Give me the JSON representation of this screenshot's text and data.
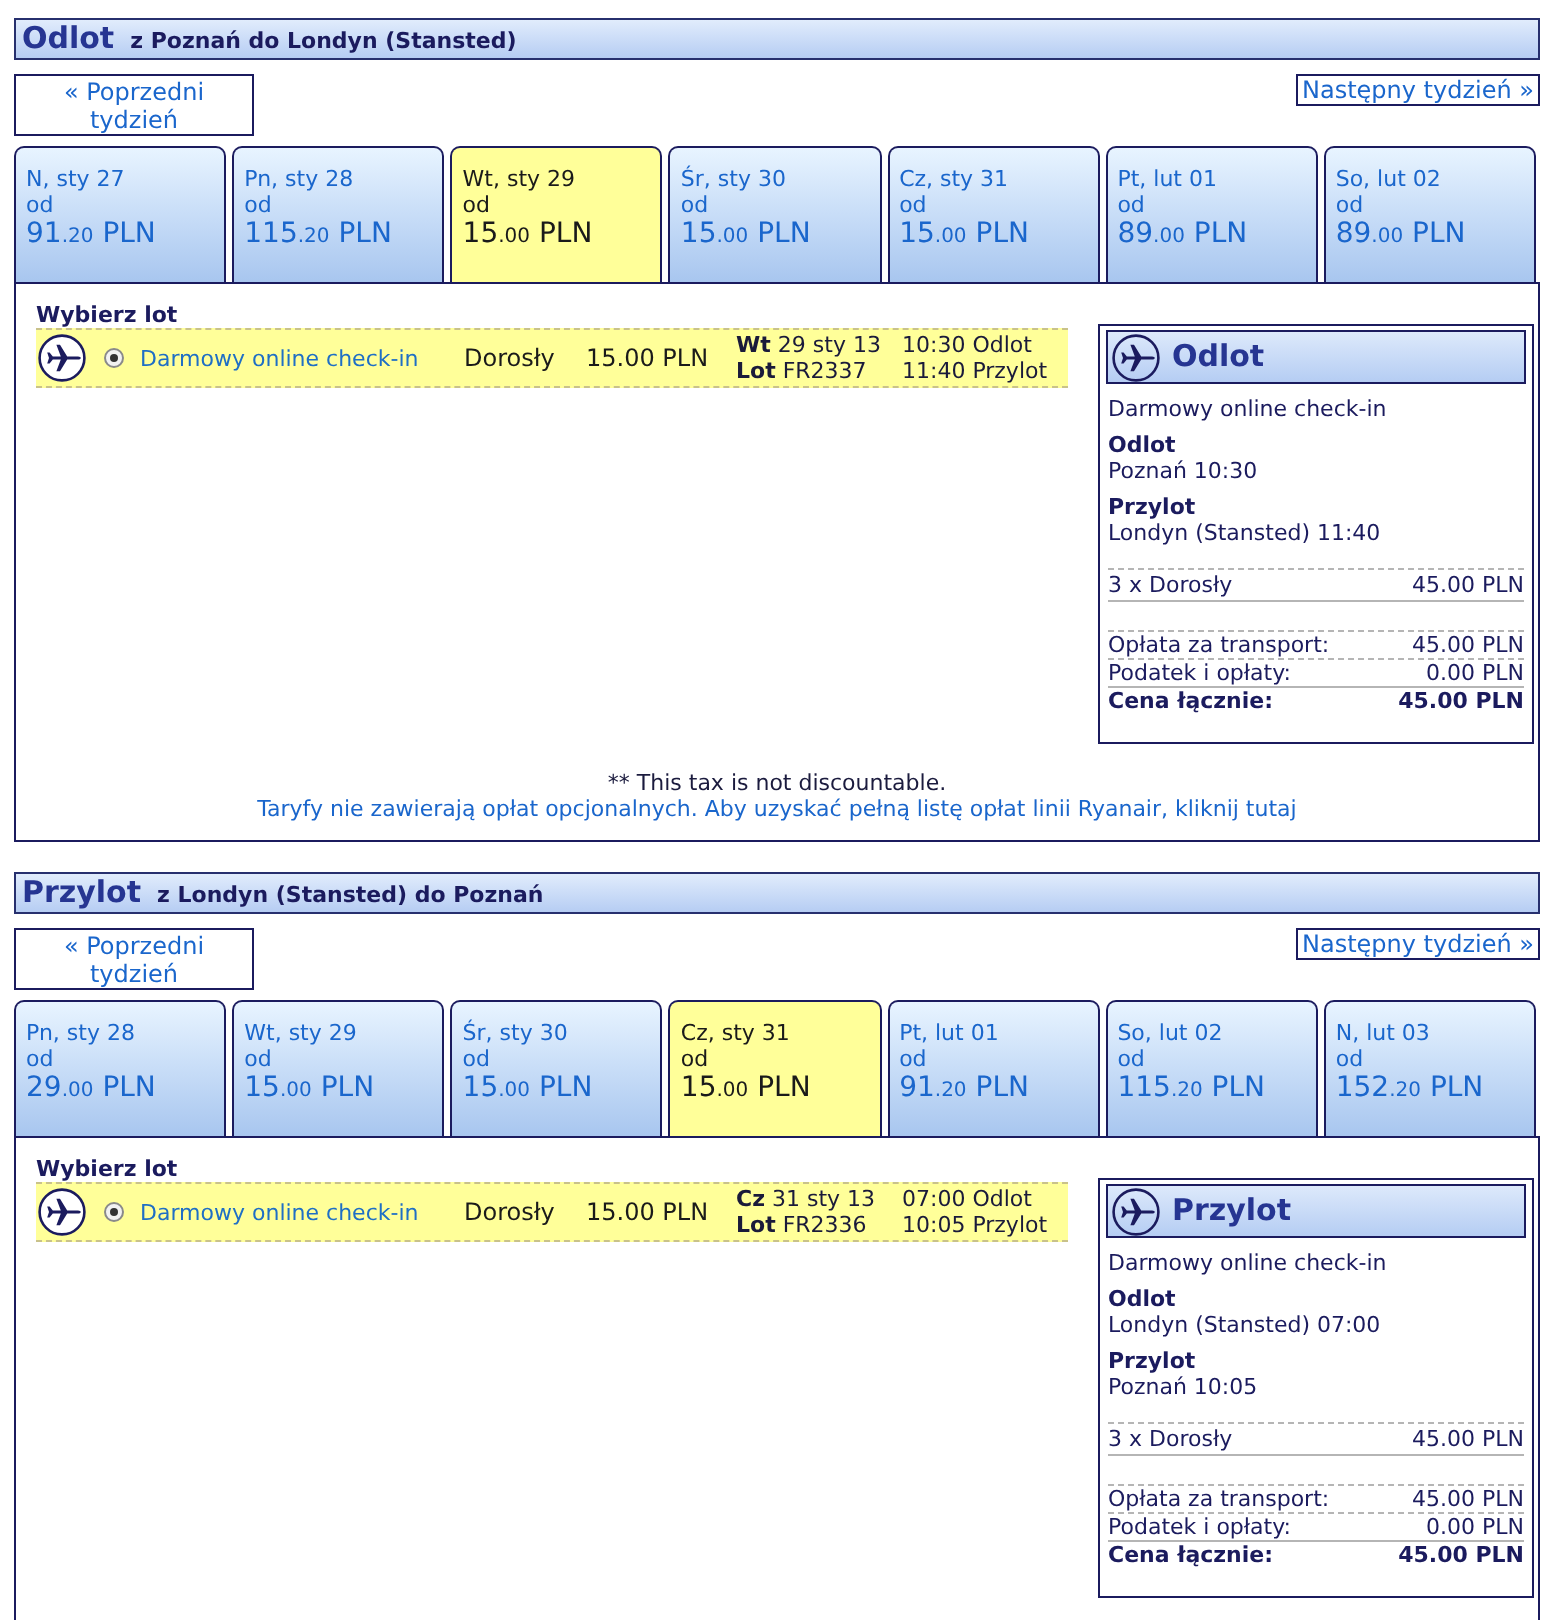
{
  "sections": [
    {
      "title": "Odlot",
      "route": "z Poznań do Londyn (Stansted)",
      "prev_week": "« Poprzedni tydzień",
      "next_week": "Następny tydzień »",
      "date_tabs": [
        {
          "date": "N, sty 27",
          "from": "od",
          "price": {
            "whole": "91",
            "fraction": ".20",
            "currency": "PLN"
          },
          "selected": false
        },
        {
          "date": "Pn, sty 28",
          "from": "od",
          "price": {
            "whole": "115",
            "fraction": ".20",
            "currency": "PLN"
          },
          "selected": false
        },
        {
          "date": "Wt, sty 29",
          "from": "od",
          "price": {
            "whole": "15",
            "fraction": ".00",
            "currency": "PLN"
          },
          "selected": true
        },
        {
          "date": "Śr, sty 30",
          "from": "od",
          "price": {
            "whole": "15",
            "fraction": ".00",
            "currency": "PLN"
          },
          "selected": false
        },
        {
          "date": "Cz, sty 31",
          "from": "od",
          "price": {
            "whole": "15",
            "fraction": ".00",
            "currency": "PLN"
          },
          "selected": false
        },
        {
          "date": "Pt, lut 01",
          "from": "od",
          "price": {
            "whole": "89",
            "fraction": ".00",
            "currency": "PLN"
          },
          "selected": false
        },
        {
          "date": "So, lut 02",
          "from": "od",
          "price": {
            "whole": "89",
            "fraction": ".00",
            "currency": "PLN"
          },
          "selected": false
        }
      ],
      "flight_list": {
        "heading": "Wybierz lot",
        "flights": [
          {
            "selected": true,
            "fare": "Darmowy online check-in",
            "passenger": "Dorosły",
            "price": "15.00 PLN",
            "date": "**Wt** 29 sty 13",
            "flight_number": "**Lot** FR2337",
            "departure": "10:30 Odlot",
            "arrival": "11:40 Przylot"
          }
        ]
      },
      "summary": {
        "title": "Odlot",
        "fare": "Darmowy online check-in",
        "departure_label": "Odlot",
        "departure": "Poznań 10:30",
        "arrival_label": "Przylot",
        "arrival": "Londyn (Stansted) 11:40",
        "passengers": {
          "label": "3 x Dorosły",
          "amount": "45.00 PLN"
        },
        "charges": [
          {
            "label": "Opłata za transport:",
            "amount": "45.00 PLN"
          },
          {
            "label": "Podatek i opłaty:",
            "amount": "0.00 PLN"
          }
        ],
        "total": {
          "label": "Cena łącznie:",
          "amount": "45.00 PLN"
        }
      },
      "notes": {
        "tax_note": "** This tax is not discountable.",
        "fares_link": "Taryfy nie zawierają opłat opcjonalnych. Aby uzyskać pełną listę opłat linii Ryanair, kliknij tutaj"
      }
    },
    {
      "title": "Przylot",
      "route": "z Londyn (Stansted) do Poznań",
      "prev_week": "« Poprzedni tydzień",
      "next_week": "Następny tydzień »",
      "date_tabs": [
        {
          "date": "Pn, sty 28",
          "from": "od",
          "price": {
            "whole": "29",
            "fraction": ".00",
            "currency": "PLN"
          },
          "selected": false
        },
        {
          "date": "Wt, sty 29",
          "from": "od",
          "price": {
            "whole": "15",
            "fraction": ".00",
            "currency": "PLN"
          },
          "selected": false
        },
        {
          "date": "Śr, sty 30",
          "from": "od",
          "price": {
            "whole": "15",
            "fraction": ".00",
            "currency": "PLN"
          },
          "selected": false
        },
        {
          "date": "Cz, sty 31",
          "from": "od",
          "price": {
            "whole": "15",
            "fraction": ".00",
            "currency": "PLN"
          },
          "selected": true
        },
        {
          "date": "Pt, lut 01",
          "from": "od",
          "price": {
            "whole": "91",
            "fraction": ".20",
            "currency": "PLN"
          },
          "selected": false
        },
        {
          "date": "So, lut 02",
          "from": "od",
          "price": {
            "whole": "115",
            "fraction": ".20",
            "currency": "PLN"
          },
          "selected": false
        },
        {
          "date": "N, lut 03",
          "from": "od",
          "price": {
            "whole": "152",
            "fraction": ".20",
            "currency": "PLN"
          },
          "selected": false
        }
      ],
      "flight_list": {
        "heading": "Wybierz lot",
        "flights": [
          {
            "selected": true,
            "fare": "Darmowy online check-in",
            "passenger": "Dorosły",
            "price": "15.00 PLN",
            "date": "**Cz** 31 sty 13",
            "flight_number": "**Lot** FR2336",
            "departure": "07:00 Odlot",
            "arrival": "10:05 Przylot"
          }
        ]
      },
      "summary": {
        "title": "Przylot",
        "fare": "Darmowy online check-in",
        "departure_label": "Odlot",
        "departure": "Londyn (Stansted) 07:00",
        "arrival_label": "Przylot",
        "arrival": "Poznań 10:05",
        "passengers": {
          "label": "3 x Dorosły",
          "amount": "45.00 PLN"
        },
        "charges": [
          {
            "label": "Opłata za transport:",
            "amount": "45.00 PLN"
          },
          {
            "label": "Podatek i opłaty:",
            "amount": "0.00 PLN"
          }
        ],
        "total": {
          "label": "Cena łącznie:",
          "amount": "45.00 PLN"
        }
      }
    }
  ]
}
